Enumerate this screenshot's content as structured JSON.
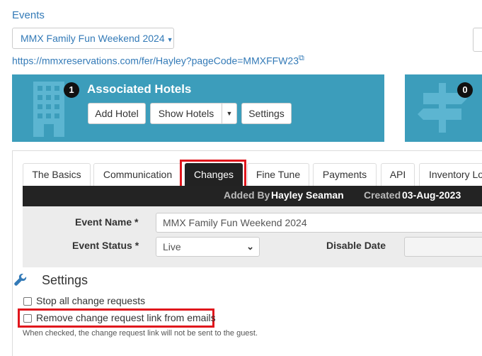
{
  "header": {
    "events_link": "Events",
    "event_selector": "MMX Family Fun Weekend 2024",
    "event_url": "https://mmxreservations.com/fer/Hayley?pageCode=MMXFFW23"
  },
  "hotels_panel": {
    "count": "1",
    "title": "Associated Hotels",
    "add_hotel": "Add Hotel",
    "show_hotels": "Show Hotels",
    "settings": "Settings"
  },
  "second_panel": {
    "count": "0"
  },
  "tabs": [
    {
      "label": "The Basics"
    },
    {
      "label": "Communication"
    },
    {
      "label": "Changes"
    },
    {
      "label": "Fine Tune"
    },
    {
      "label": "Payments"
    },
    {
      "label": "API"
    },
    {
      "label": "Inventory Lo"
    }
  ],
  "info_bar": {
    "added_by_label": "Added By",
    "added_by_value": "Hayley Seaman",
    "created_label": "Created",
    "created_value": "03-Aug-2023"
  },
  "form": {
    "event_name_label": "Event Name *",
    "event_name_value": "MMX Family Fun Weekend 2024",
    "event_status_label": "Event Status *",
    "event_status_value": "Live",
    "disable_date_label": "Disable Date"
  },
  "settings": {
    "heading": "Settings",
    "stop_all": "Stop all change requests",
    "remove_link": "Remove change request link from emails",
    "hint": "When checked, the change request link will not be sent to the guest."
  },
  "colors": {
    "panel": "#3c9dbb",
    "link": "#337ab7",
    "highlight": "#e0161c",
    "active_tab": "#222222"
  }
}
